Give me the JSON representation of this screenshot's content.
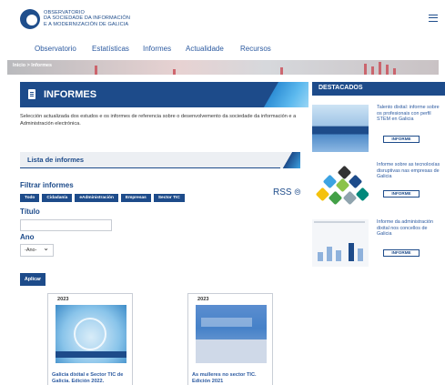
{
  "header": {
    "brand_line1": "OBSERVATORIO",
    "brand_line2": "DA SOCIEDADE DA INFORMACIÓN",
    "brand_line3": "E A MODERNIZACIÓN DE GALICIA",
    "menu_icon": "hamburger-menu-icon"
  },
  "nav": {
    "items": [
      "Observatorio",
      "Estatísticas",
      "Informes",
      "Actualidade",
      "Recursos"
    ]
  },
  "breadcrumb": "Inicio > Informes",
  "informes": {
    "title": "INFORMES",
    "intro": "Selección actualizada dos estudos e os informes de referencia sobre o desenvolvemento da sociedade da información e a Administración electrónica."
  },
  "lista": {
    "title": "Lista de informes",
    "filter_title": "Filtrar informes",
    "tags": [
      "Todo",
      "Cidadanía",
      "eAdministración",
      "Empresas",
      "Sector TIC"
    ],
    "rss_label": "RSS",
    "titulo_label": "Título",
    "titulo_value": "",
    "ano_label": "Ano",
    "ano_selected": "-Ano-",
    "apply_label": "Aplicar"
  },
  "cards": [
    {
      "year": "2023",
      "title": "Galicia dixital e Sector TIC de Galicia. Edición 2022."
    },
    {
      "year": "2023",
      "title": "As mulleres no sector TIC. Edición 2021"
    }
  ],
  "sidebar": {
    "title": "DESTACADOS",
    "items": [
      {
        "text": "Talento dixital: informe sobre os profesionais con perfil STEM en Galicia",
        "button": "INFORME"
      },
      {
        "text": "Informe sobre as tecnoloxías disruptivas nas empresas de Galicia",
        "button": "INFORME"
      },
      {
        "text": "Informe da administración dixital nos concellos de Galicia",
        "button": "INFORME"
      }
    ]
  },
  "colors": {
    "primary": "#1d4b8a",
    "accent": "#3da3e2",
    "link": "#2c5aa0"
  }
}
